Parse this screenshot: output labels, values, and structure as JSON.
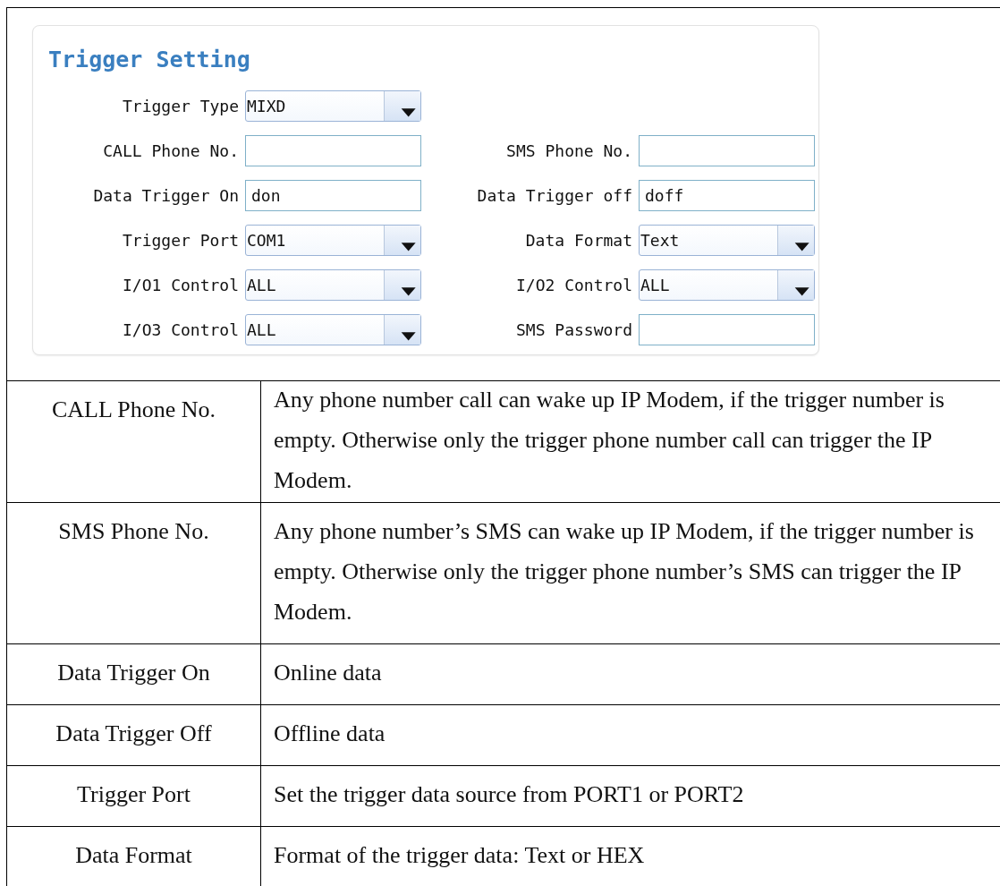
{
  "settings_panel": {
    "title": "Trigger Setting",
    "rows": [
      [
        {
          "label": "Trigger Type",
          "kind": "select",
          "value": "MIXD"
        }
      ],
      [
        {
          "label": "CALL Phone No.",
          "kind": "text"
        },
        {
          "label": "SMS Phone No.",
          "kind": "text"
        }
      ],
      [
        {
          "label": "Data Trigger On",
          "kind": "text",
          "value": "don"
        },
        {
          "label": "Data Trigger off",
          "kind": "text",
          "value": "doff"
        }
      ],
      [
        {
          "label": "Trigger Port",
          "kind": "select",
          "value": "COM1"
        },
        {
          "label": "Data Format",
          "kind": "select",
          "value": "Text"
        }
      ],
      [
        {
          "label": "I/O1 Control",
          "kind": "select",
          "value": "ALL"
        },
        {
          "label": "I/O2 Control",
          "kind": "select",
          "value": "ALL"
        }
      ],
      [
        {
          "label": "I/O3 Control",
          "kind": "select",
          "value": "ALL"
        },
        {
          "label": "SMS Password",
          "kind": "text"
        }
      ]
    ]
  },
  "table": {
    "rows": [
      {
        "term": "CALL Phone No.",
        "description": "Any phone number call can wake up IP Modem, if the trigger number is empty. Otherwise only the trigger phone number call can trigger the IP Modem."
      },
      {
        "term": "SMS Phone No.",
        "description": "Any phone number’s SMS can wake up IP Modem, if the trigger number is empty. Otherwise only the trigger phone number’s SMS can trigger the IP Modem."
      },
      {
        "term": "Data Trigger On",
        "description": "Online data"
      },
      {
        "term": "Data Trigger Off",
        "description": "Offline data"
      },
      {
        "term": "Trigger Port",
        "description": "Set the trigger data source from PORT1 or PORT2"
      },
      {
        "term": "Data Format",
        "description": "Format of the trigger data: Text or HEX"
      }
    ]
  }
}
